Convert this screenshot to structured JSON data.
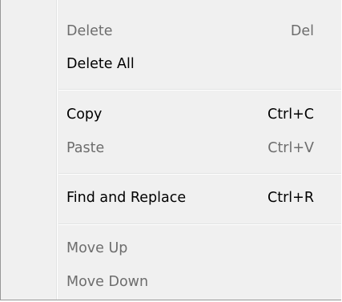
{
  "menu": {
    "items": [
      {
        "label": "Delete",
        "shortcut": "Del",
        "enabled": false
      },
      {
        "label": "Delete All",
        "shortcut": "",
        "enabled": true
      },
      {
        "label": "Copy",
        "shortcut": "Ctrl+C",
        "enabled": true
      },
      {
        "label": "Paste",
        "shortcut": "Ctrl+V",
        "enabled": false
      },
      {
        "label": "Find and Replace",
        "shortcut": "Ctrl+R",
        "enabled": true
      },
      {
        "label": "Move Up",
        "shortcut": "",
        "enabled": false
      },
      {
        "label": "Move Down",
        "shortcut": "",
        "enabled": false
      }
    ]
  },
  "colors": {
    "background": "#f0f0f0",
    "text_enabled": "#000000",
    "text_disabled": "#6d6d6d",
    "separator": "#e2e3e3",
    "border": "#979797"
  }
}
